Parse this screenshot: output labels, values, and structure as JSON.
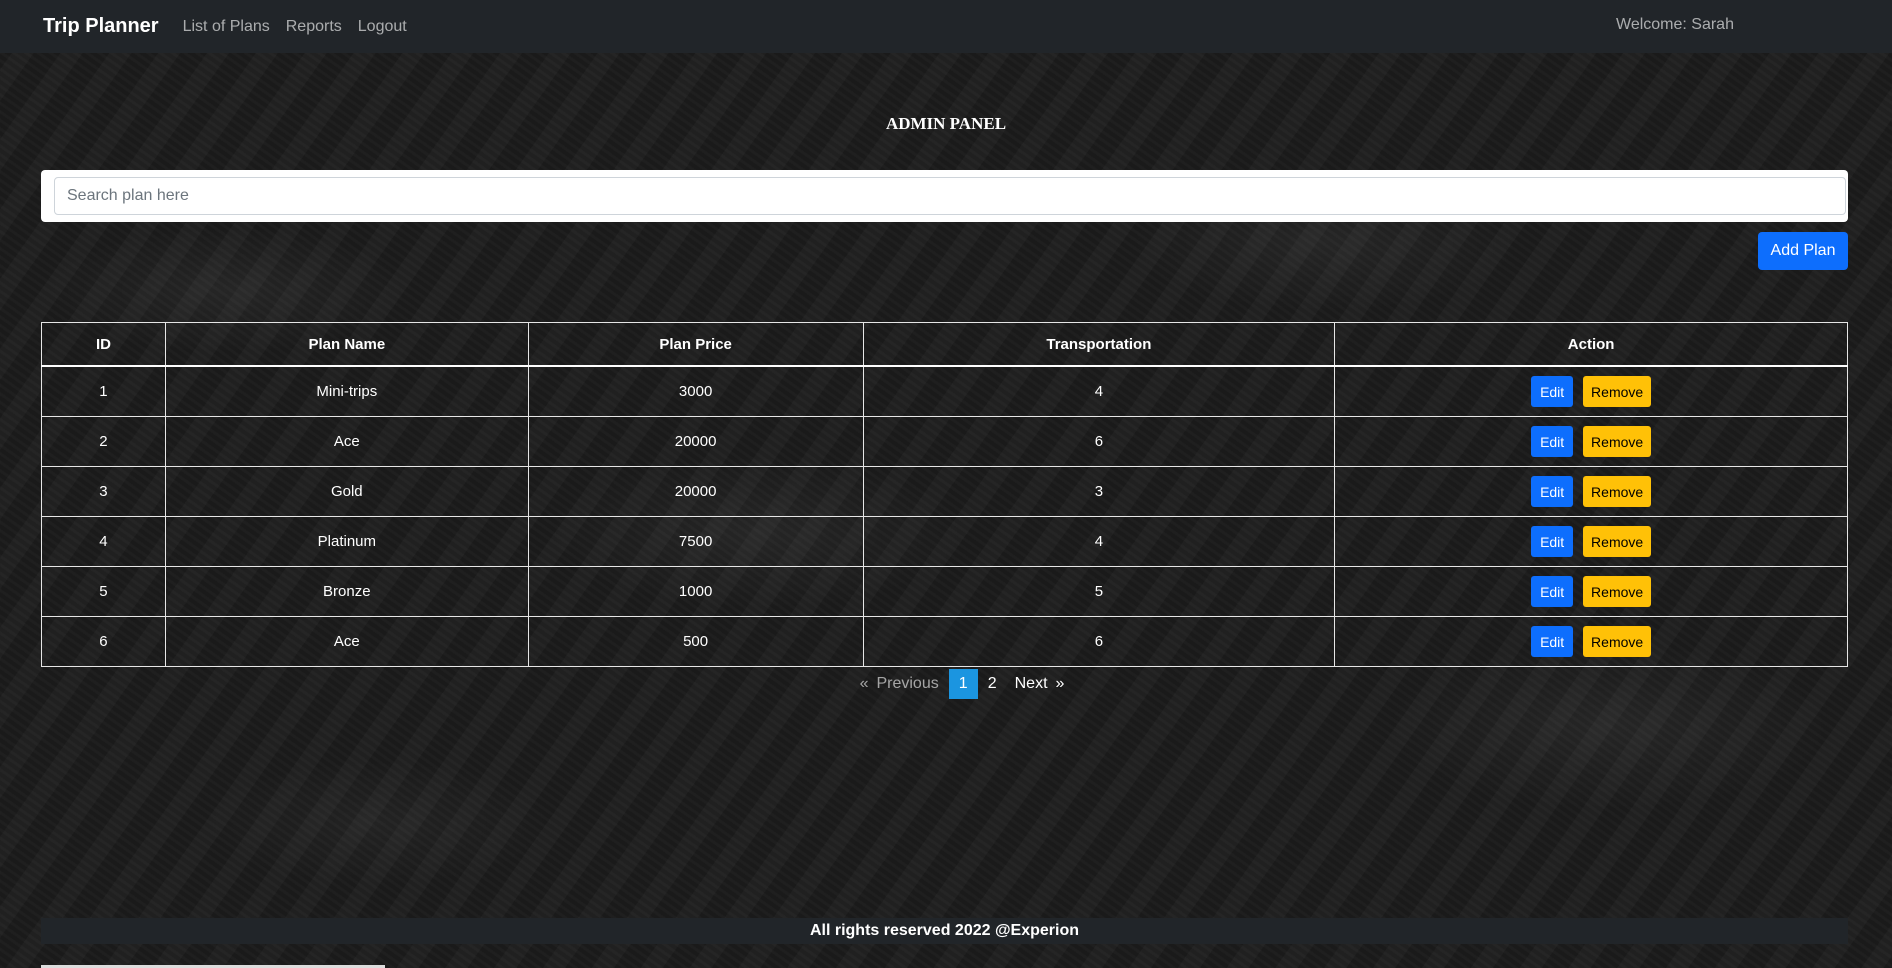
{
  "navbar": {
    "brand": "Trip Planner",
    "links": [
      "List of Plans",
      "Reports",
      "Logout"
    ],
    "welcome": "Welcome: Sarah"
  },
  "page_title": "ADMIN PANEL",
  "search": {
    "placeholder": "Search plan here",
    "value": ""
  },
  "add_plan_label": "Add Plan",
  "table": {
    "headers": [
      "ID",
      "Plan Name",
      "Plan Price",
      "Transportation",
      "Action"
    ],
    "rows": [
      {
        "id": "1",
        "name": "Mini-trips",
        "price": "3000",
        "transportation": "4"
      },
      {
        "id": "2",
        "name": "Ace",
        "price": "20000",
        "transportation": "6"
      },
      {
        "id": "3",
        "name": "Gold",
        "price": "20000",
        "transportation": "3"
      },
      {
        "id": "4",
        "name": "Platinum",
        "price": "7500",
        "transportation": "4"
      },
      {
        "id": "5",
        "name": "Bronze",
        "price": "1000",
        "transportation": "5"
      },
      {
        "id": "6",
        "name": "Ace",
        "price": "500",
        "transportation": "6"
      }
    ],
    "edit_label": "Edit",
    "remove_label": "Remove"
  },
  "pagination": {
    "prev_arrow": "«",
    "prev_label": "Previous",
    "pages": [
      "1",
      "2"
    ],
    "current": "1",
    "next_label": "Next",
    "next_arrow": "»"
  },
  "footer": "All rights reserved 2022 @Experion",
  "colors": {
    "navbar": "#212529",
    "primary": "#0d6efd",
    "warning": "#ffc107",
    "page_active": "#1b95e0"
  }
}
